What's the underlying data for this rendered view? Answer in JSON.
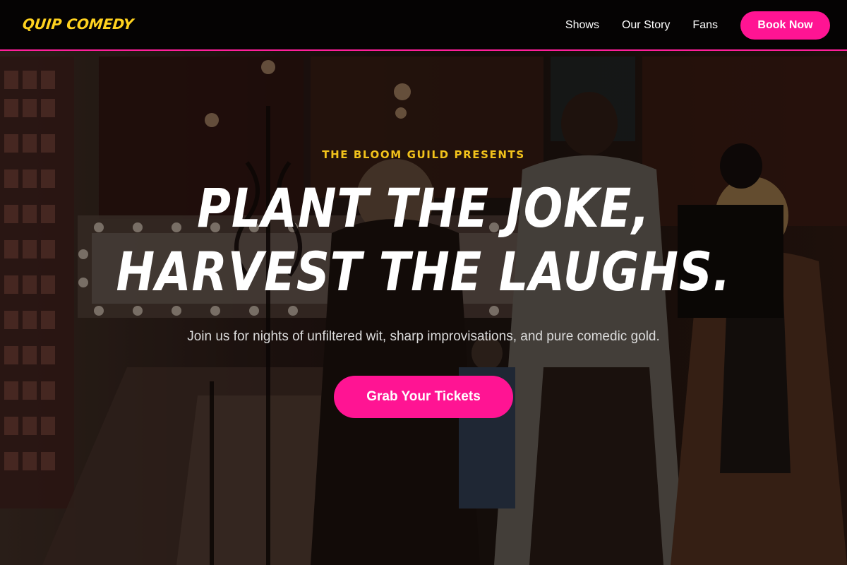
{
  "header": {
    "logo": "QUIP COMEDY",
    "nav": [
      {
        "label": "Shows"
      },
      {
        "label": "Our Story"
      },
      {
        "label": "Fans"
      }
    ],
    "cta_label": "Book Now"
  },
  "hero": {
    "eyebrow": "THE BLOOM GUILD PRESENTS",
    "headline_line1": "PLANT THE JOKE,",
    "headline_line2": "HARVEST THE LAUGHS.",
    "subtitle": "Join us for nights of unfiltered wit, sharp improvisations, and pure comedic gold.",
    "cta_label": "Grab Your Tickets"
  },
  "colors": {
    "accent_pink": "#ff1493",
    "logo_yellow": "#ffd21f",
    "eyebrow_yellow": "#f2c21b",
    "header_bg": "#050303"
  }
}
